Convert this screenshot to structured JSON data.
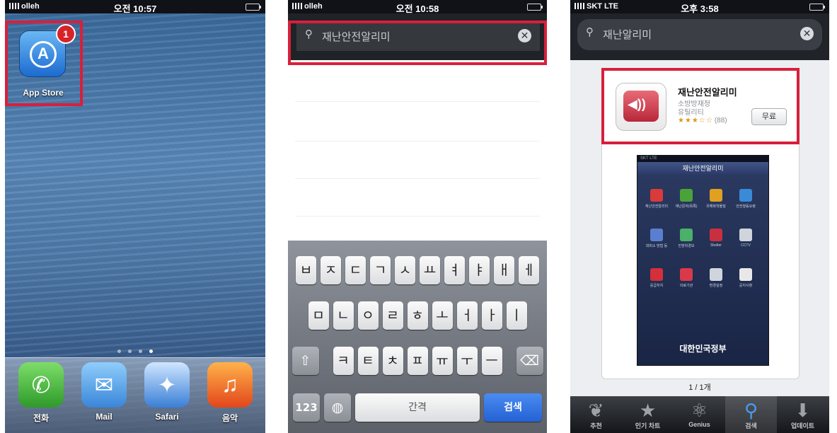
{
  "screen1": {
    "status": {
      "carrier": "olleh",
      "time": "오전 10:57"
    },
    "badge": "1",
    "app_store_label": "App Store",
    "dock": [
      {
        "label": "전화",
        "icon": "phone-icon"
      },
      {
        "label": "Mail",
        "icon": "mail-icon"
      },
      {
        "label": "Safari",
        "icon": "safari-icon"
      },
      {
        "label": "음악",
        "icon": "music-icon"
      }
    ]
  },
  "screen2": {
    "status": {
      "carrier": "olleh",
      "time": "오전 10:58"
    },
    "search": {
      "value": "재난안전알리미"
    },
    "keyboard": {
      "row1": [
        "ㅂ",
        "ㅈ",
        "ㄷ",
        "ㄱ",
        "ㅅ",
        "ㅛ",
        "ㅕ",
        "ㅑ",
        "ㅐ",
        "ㅔ"
      ],
      "row2": [
        "ㅁ",
        "ㄴ",
        "ㅇ",
        "ㄹ",
        "ㅎ",
        "ㅗ",
        "ㅓ",
        "ㅏ",
        "ㅣ"
      ],
      "row3": [
        "ㅋ",
        "ㅌ",
        "ㅊ",
        "ㅍ",
        "ㅠ",
        "ㅜ",
        "ㅡ"
      ],
      "numbers_key": "123",
      "space_key": "간격",
      "search_key": "검색"
    }
  },
  "screen3": {
    "status": {
      "carrier": "SKT  LTE",
      "time": "오후 3:58"
    },
    "search": {
      "value": "재난알리미"
    },
    "app": {
      "name": "재난안전알리미",
      "seller": "소방방재청",
      "category": "유틸리티",
      "stars": "★★★☆☆",
      "rating_count": "(88)",
      "price_button": "무료"
    },
    "screenshot": {
      "status": "SKT LTE",
      "title": "재난안전알리미",
      "gov_label": "대한민국정부",
      "items": [
        "재난안전알리미",
        "재난문자(목록)",
        "유해화학물질",
        "안전행동요령",
        "대피소 방법 등",
        "민방위경보",
        "Shelter",
        "CCTV",
        "응급처치",
        "의료기관",
        "환경설정",
        "공지사항"
      ]
    },
    "pager": "1 / 1개",
    "tabs": [
      {
        "label": "추천",
        "icon": "featured-icon"
      },
      {
        "label": "인기 차트",
        "icon": "star-icon"
      },
      {
        "label": "Genius",
        "icon": "genius-icon"
      },
      {
        "label": "검색",
        "icon": "search-icon"
      },
      {
        "label": "업데이트",
        "icon": "updates-icon"
      }
    ]
  }
}
